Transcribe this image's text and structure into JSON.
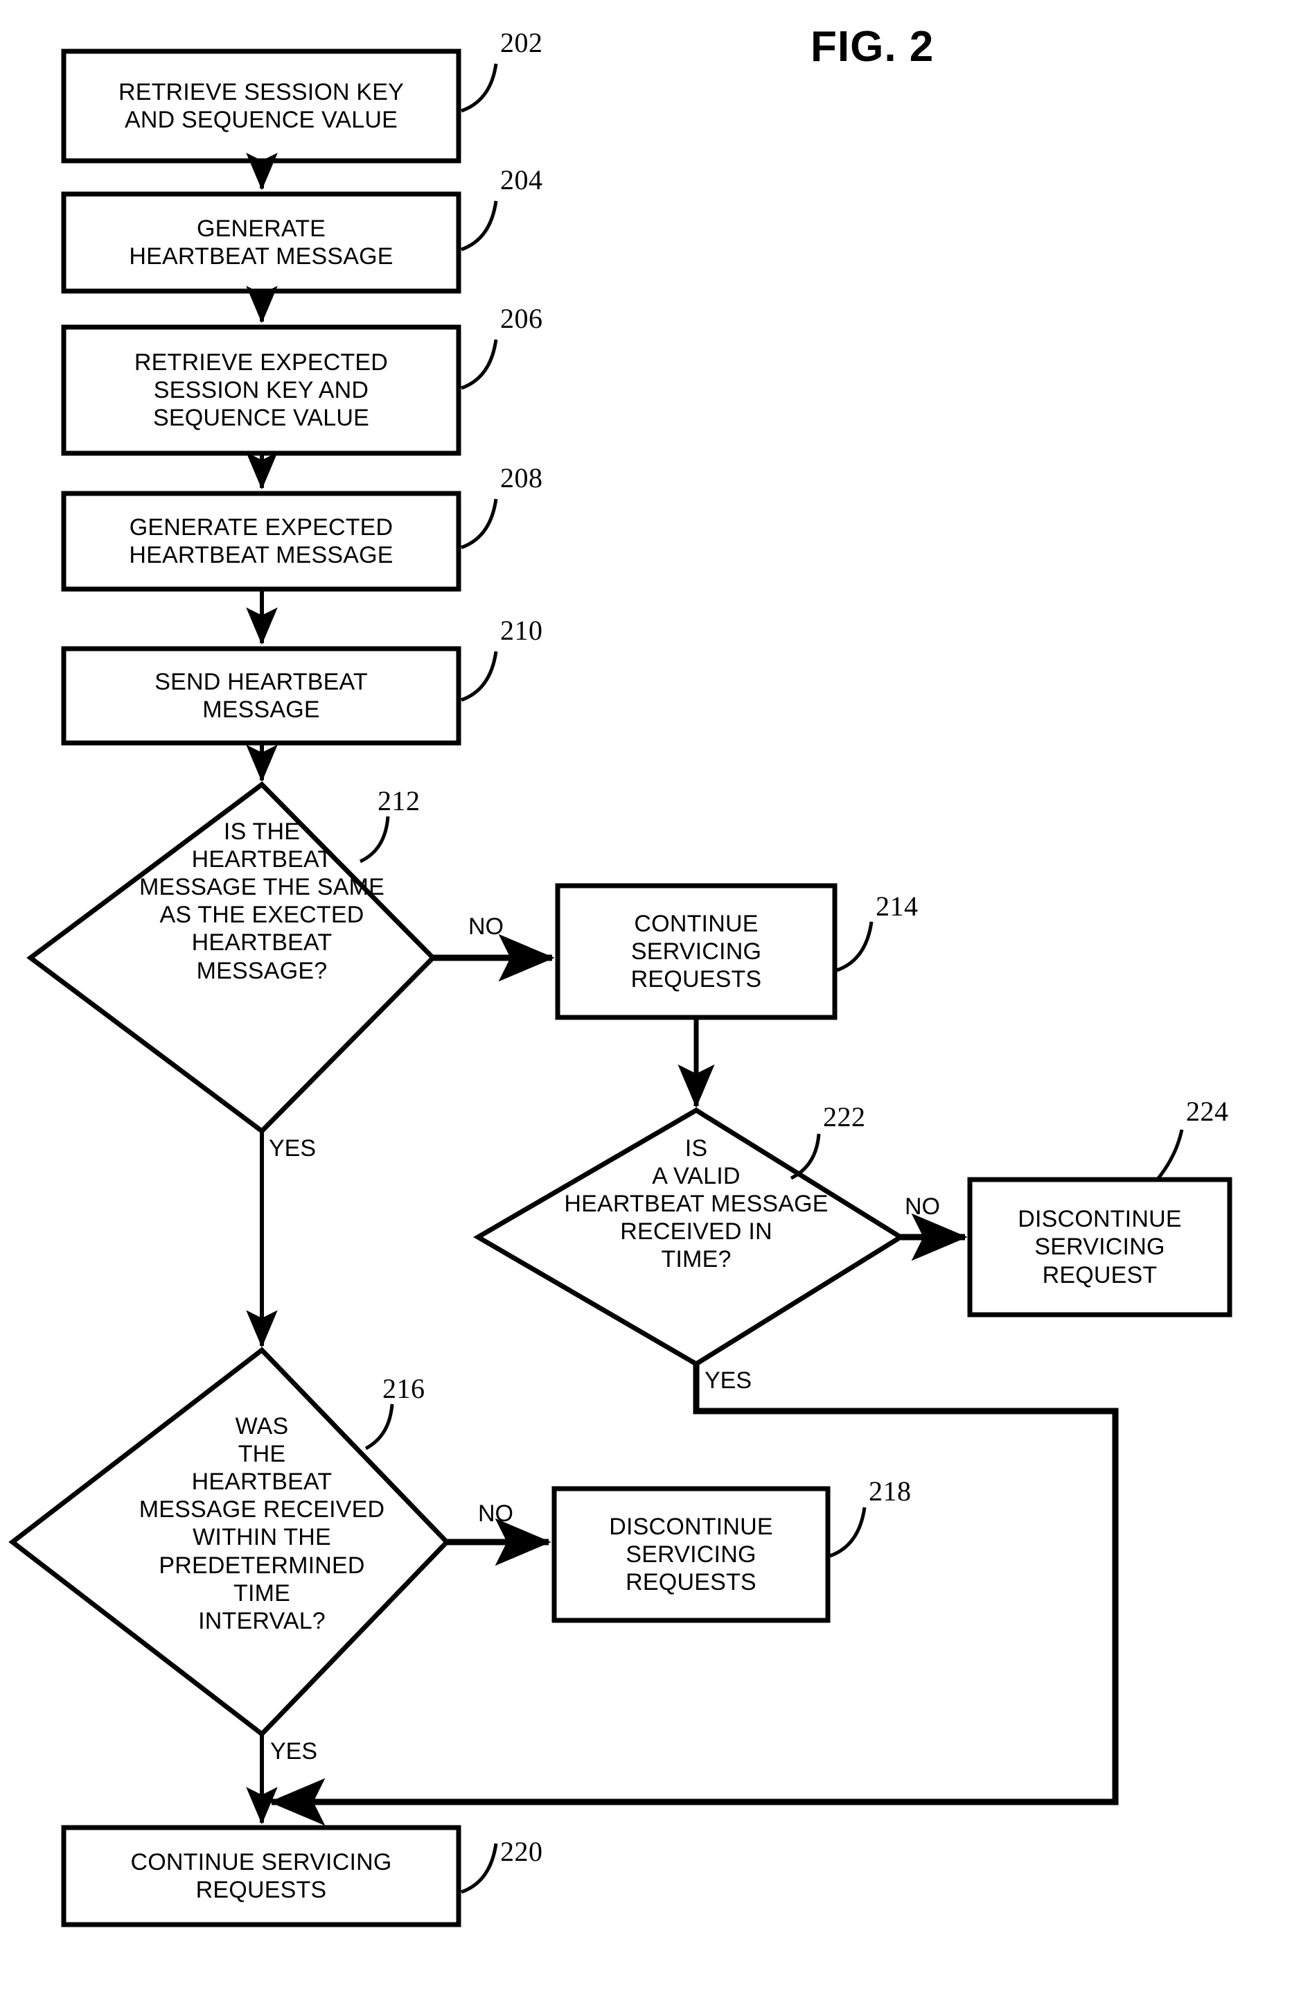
{
  "figure": {
    "title": "FIG. 2",
    "type": "patent-flowchart"
  },
  "nodes": [
    {
      "id": "202",
      "shape": "process",
      "ref": "202",
      "lines": [
        "RETRIEVE SESSION KEY",
        "AND SEQUENCE VALUE"
      ]
    },
    {
      "id": "204",
      "shape": "process",
      "ref": "204",
      "lines": [
        "GENERATE",
        "HEARTBEAT MESSAGE"
      ]
    },
    {
      "id": "206",
      "shape": "process",
      "ref": "206",
      "lines": [
        "RETRIEVE EXPECTED",
        "SESSION KEY AND",
        "SEQUENCE VALUE"
      ]
    },
    {
      "id": "208",
      "shape": "process",
      "ref": "208",
      "lines": [
        "GENERATE EXPECTED",
        "HEARTBEAT MESSAGE"
      ]
    },
    {
      "id": "210",
      "shape": "process",
      "ref": "210",
      "lines": [
        "SEND HEARTBEAT",
        "MESSAGE"
      ]
    },
    {
      "id": "212",
      "shape": "decision",
      "ref": "212",
      "lines": [
        "IS THE",
        "HEARTBEAT",
        "MESSAGE THE SAME",
        "AS THE EXECTED",
        "HEARTBEAT",
        "MESSAGE?"
      ]
    },
    {
      "id": "214",
      "shape": "process",
      "ref": "214",
      "lines": [
        "CONTINUE",
        "SERVICING",
        "REQUESTS"
      ]
    },
    {
      "id": "222",
      "shape": "decision",
      "ref": "222",
      "lines": [
        "IS",
        "A VALID",
        "HEARTBEAT MESSAGE",
        "RECEIVED IN",
        "TIME?"
      ]
    },
    {
      "id": "224",
      "shape": "process",
      "ref": "224",
      "lines": [
        "DISCONTINUE",
        "SERVICING",
        "REQUEST"
      ]
    },
    {
      "id": "216",
      "shape": "decision",
      "ref": "216",
      "lines": [
        "WAS",
        "THE",
        "HEARTBEAT",
        "MESSAGE RECEIVED",
        "WITHIN THE",
        "PREDETERMINED",
        "TIME",
        "INTERVAL?"
      ]
    },
    {
      "id": "218",
      "shape": "process",
      "ref": "218",
      "lines": [
        "DISCONTINUE",
        "SERVICING",
        "REQUESTS"
      ]
    },
    {
      "id": "220",
      "shape": "process",
      "ref": "220",
      "lines": [
        "CONTINUE SERVICING",
        "REQUESTS"
      ]
    }
  ],
  "edge_labels": [
    {
      "id": "212-no",
      "text": "NO"
    },
    {
      "id": "212-yes",
      "text": "YES"
    },
    {
      "id": "222-no",
      "text": "NO"
    },
    {
      "id": "222-yes",
      "text": "YES"
    },
    {
      "id": "216-no",
      "text": "NO"
    },
    {
      "id": "216-yes",
      "text": "YES"
    }
  ],
  "colors": {
    "ink": "#000000",
    "paper": "#ffffff"
  }
}
